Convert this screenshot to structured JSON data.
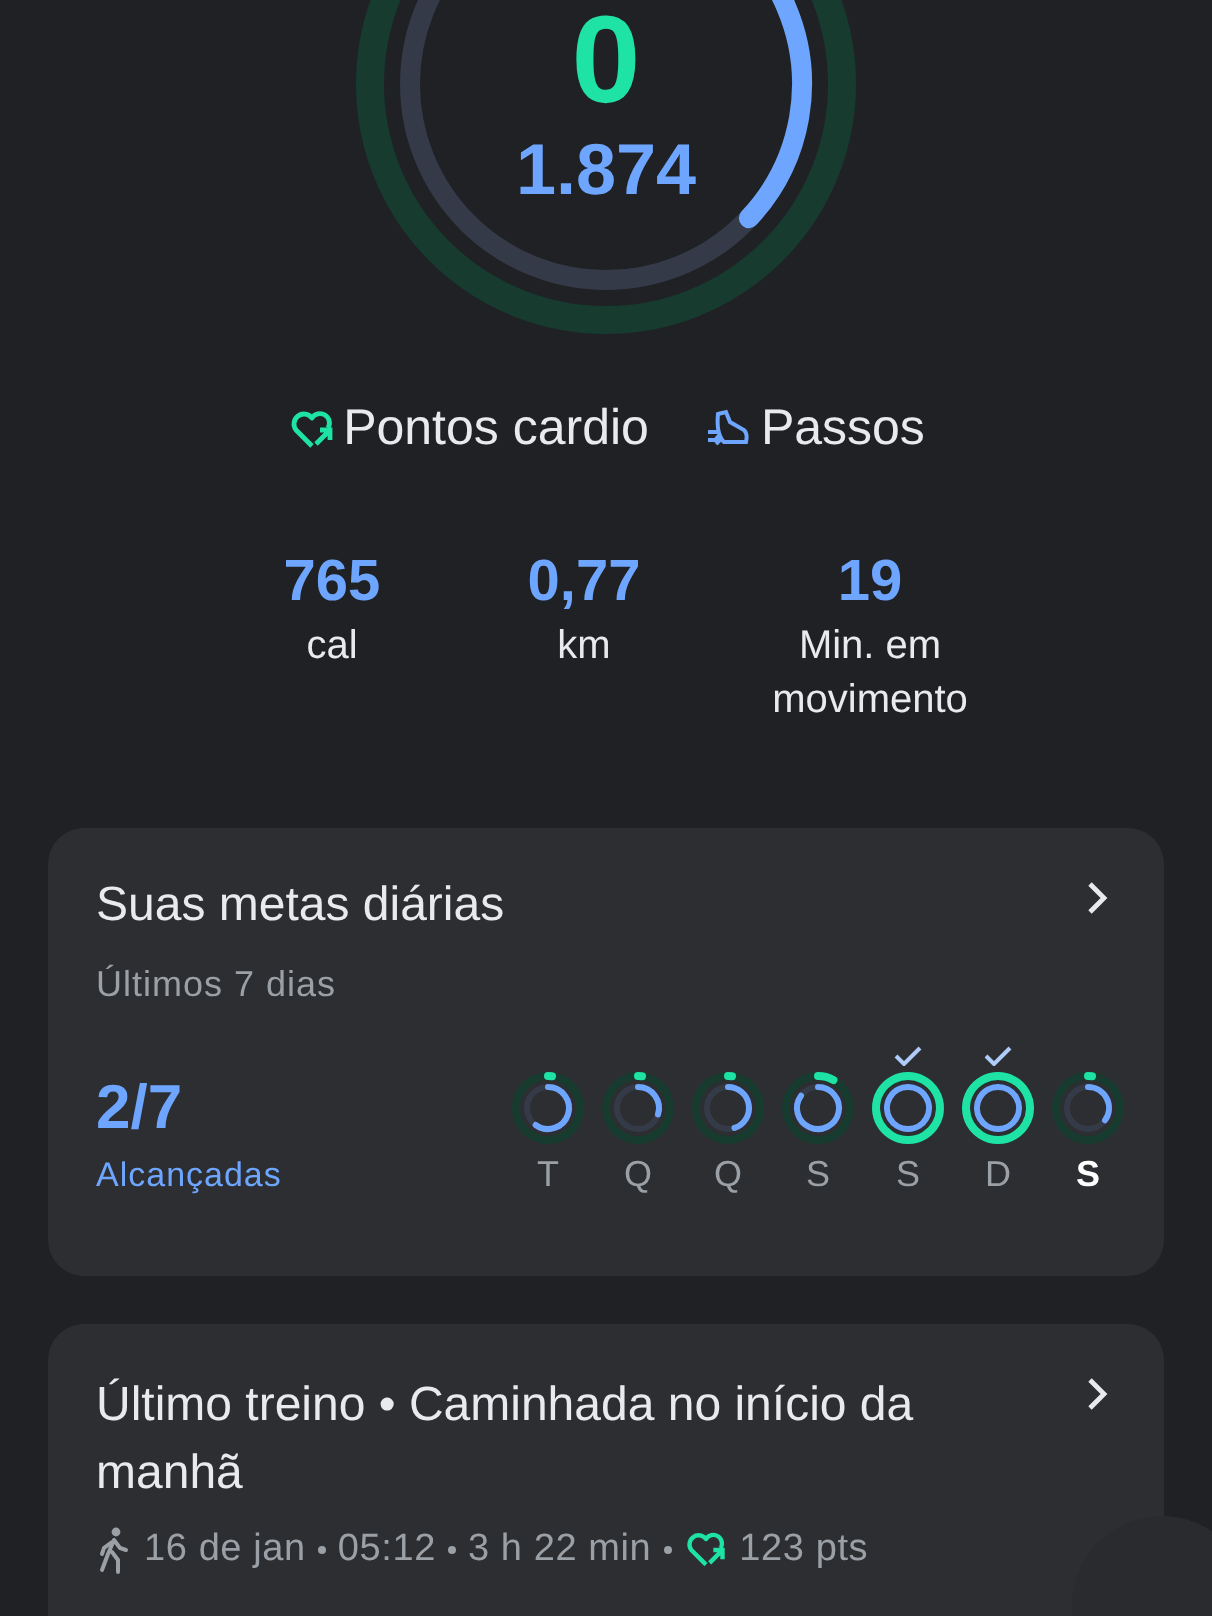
{
  "summary": {
    "cardio_value": "0",
    "steps_value": "1.874"
  },
  "legend": [
    {
      "kind": "cardio",
      "label": "Pontos cardio"
    },
    {
      "kind": "steps",
      "label": "Passos"
    }
  ],
  "stats": [
    {
      "value": "765",
      "unit": "cal"
    },
    {
      "value": "0,77",
      "unit": "km"
    },
    {
      "value": "19",
      "unit": "Min. em movimento"
    }
  ],
  "daily_goals": {
    "title": "Suas metas diárias",
    "subtitle": "Últimos 7 dias",
    "count": "2/7",
    "count_label": "Alcançadas",
    "days": [
      {
        "label": "T",
        "achieved": false,
        "selected": false
      },
      {
        "label": "Q",
        "achieved": false,
        "selected": false
      },
      {
        "label": "Q",
        "achieved": false,
        "selected": false
      },
      {
        "label": "S",
        "achieved": false,
        "selected": false
      },
      {
        "label": "S",
        "achieved": true,
        "selected": false
      },
      {
        "label": "D",
        "achieved": true,
        "selected": false
      },
      {
        "label": "S",
        "achieved": false,
        "selected": true
      }
    ]
  },
  "last_workout": {
    "title": "Último treino • Caminhada no início da manhã",
    "date": "16 de jan",
    "time": "05:12",
    "duration": "3 h 22 min",
    "points": "123 pts"
  }
}
